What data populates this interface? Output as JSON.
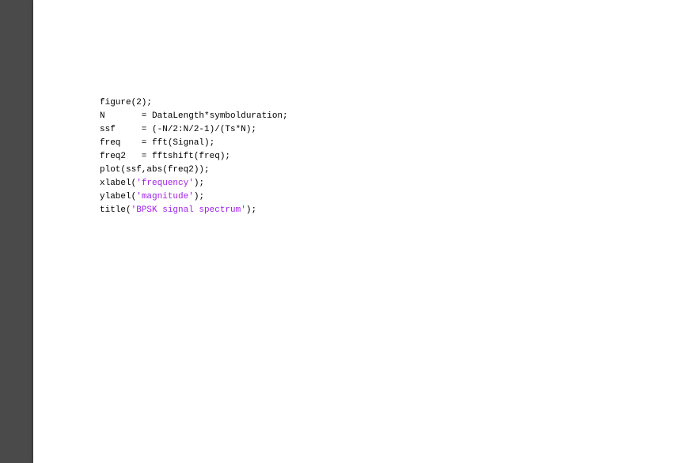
{
  "code": {
    "l1_a": "figure(2);",
    "l2_a": "N       = DataLength*symbolduration;",
    "l3_a": "ssf     = (-N/2:N/2-1)/(Ts*N);",
    "l4_a": "freq    = fft(Signal);",
    "l5_a": "freq2   = fftshift(freq);",
    "l6_a": "plot(ssf,abs(freq2));",
    "l7_a": "xlabel(",
    "l7_s": "'frequency'",
    "l7_b": ");",
    "l8_a": "ylabel(",
    "l8_s": "'magnitude'",
    "l8_b": ");",
    "l9_a": "title(",
    "l9_s": "'BPSK signal spectrum'",
    "l9_b": ");"
  }
}
